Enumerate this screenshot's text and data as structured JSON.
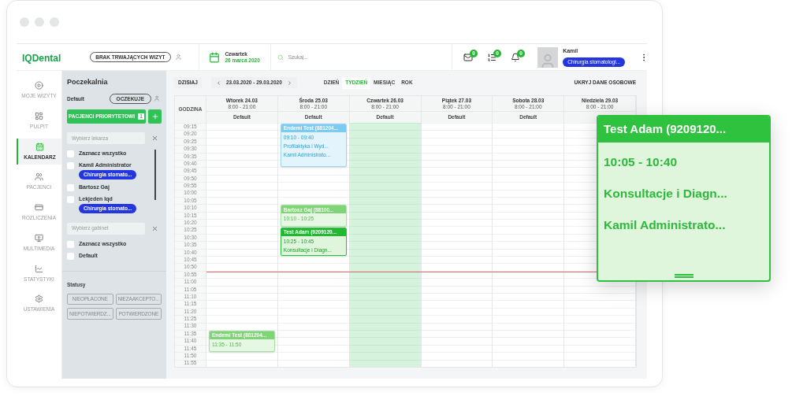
{
  "header": {
    "logo": "IQDental",
    "status_pill": "BRAK TRWAJĄCYCH WIZYT",
    "date": {
      "weekday": "Czwartek",
      "date": "26 marca 2020"
    },
    "search": {
      "placeholder": "Szukaj..."
    },
    "notifications": [
      {
        "kind": "mail",
        "count": "0"
      },
      {
        "kind": "queue",
        "count": "0"
      },
      {
        "kind": "bell",
        "count": "0"
      }
    ],
    "user": {
      "name": "Kamil",
      "role": "Chirurgia stomatologi..."
    }
  },
  "nav": [
    {
      "kind": "play",
      "label": "MOJE WIZYTY",
      "selected": false
    },
    {
      "kind": "dashboard",
      "label": "PULPIT",
      "selected": false
    },
    {
      "kind": "calendar",
      "label": "KALENDARZ",
      "selected": true
    },
    {
      "kind": "patients",
      "label": "PACJENCI",
      "selected": false
    },
    {
      "kind": "billing",
      "label": "ROZLICZENIA",
      "selected": false
    },
    {
      "kind": "media",
      "label": "MULTIMEDIA",
      "selected": false
    },
    {
      "kind": "stats",
      "label": "STATYSTYKI",
      "selected": false
    },
    {
      "kind": "settings",
      "label": "USTAWIENIA",
      "selected": false
    }
  ],
  "waiting_room": {
    "title": "Poczekalnia",
    "room": "Default",
    "status": "OCZEKUJE",
    "priority_button": "PACJENCI PRIORYTETOWI",
    "priority_count": "1",
    "doctor_select": {
      "placeholder": "Wybierz lekarza"
    },
    "doctors": [
      {
        "name": "Zaznacz wszystko",
        "checked": false
      },
      {
        "name": "Kamil Administrator",
        "tag": "Chirurgia stomato...",
        "checked": false
      },
      {
        "name": "Bartosz Gaj",
        "checked": false
      },
      {
        "name": "Lekjeden Iqd",
        "tag": "Chirurgia stomato...",
        "checked": false
      }
    ],
    "room_select": {
      "placeholder": "Wybierz gabinet"
    },
    "rooms": [
      {
        "name": "Zaznacz wszystko",
        "checked": false
      },
      {
        "name": "Default",
        "checked": false
      }
    ],
    "statuses_title": "Statusy",
    "statuses": [
      "NIEOPŁACONE",
      "NIEZAAKCEPTO...",
      "NIEPOTWIERDZ...",
      "POTWIERDZONE"
    ]
  },
  "calendar": {
    "today_button": "DZISIAJ",
    "range": "23.03.2020 - 29.03.2020",
    "views": [
      {
        "label": "DZIEŃ",
        "selected": false
      },
      {
        "label": "TYDZIEŃ",
        "selected": true
      },
      {
        "label": "MIESIĄC",
        "selected": false
      },
      {
        "label": "ROK",
        "selected": false
      }
    ],
    "hide_button": "UKRYJ DANE OSOBOWE",
    "hour_header": "GODZINA",
    "times": [
      "09:15",
      "09:20",
      "09:25",
      "09:30",
      "09:35",
      "09:40",
      "09:45",
      "09:50",
      "09:55",
      "10:00",
      "10:05",
      "10:10",
      "10:15",
      "10:20",
      "10:25",
      "10:30",
      "10:35",
      "10:40",
      "10:45",
      "10:50",
      "10:55",
      "11:00",
      "11:05",
      "11:10",
      "11:15",
      "11:20",
      "11:25",
      "11:30",
      "11:35",
      "11:40",
      "11:45",
      "11:50",
      "11:55"
    ],
    "days": [
      {
        "name": "Wtorek 24.03",
        "hours": "8:00 - 21:00",
        "room": "Default",
        "today": false,
        "events": [
          {
            "kind": "light",
            "title": "Endemi Test (881204...",
            "lines": [
              "11:35 - 11:50"
            ]
          }
        ]
      },
      {
        "name": "Środa 25.03",
        "hours": "8:00 - 21:00",
        "room": "Default",
        "today": false,
        "events": [
          {
            "kind": "blue",
            "title": "Endemi Test (881204...",
            "lines": [
              "09:10 - 09:40",
              "Profilaktyka i Wyd...",
              "Kamil Administrato..."
            ]
          },
          {
            "kind": "light",
            "title": "Bartosz Gaj (88100...",
            "lines": [
              "10:10 - 10:25"
            ]
          },
          {
            "kind": "dark",
            "title": "Test Adam (9209120...",
            "lines": [
              "10:25 - 10:45",
              "Konsultacje i Diagn..."
            ]
          }
        ]
      },
      {
        "name": "Czwartek 26.03",
        "hours": "8:00 - 21:00",
        "room": "Default",
        "today": true
      },
      {
        "name": "Piątek 27.03",
        "hours": "8:00 - 21:00",
        "room": "Default",
        "today": false
      },
      {
        "name": "Sobota 28.03",
        "hours": "8:00 - 21:00",
        "room": "Default",
        "today": false
      },
      {
        "name": "Niedziela 29.03",
        "hours": "8:00 - 21:00",
        "today": false
      }
    ]
  },
  "callout": {
    "title": "Test Adam (9209120...",
    "lines": [
      "10:05 - 10:40",
      "Konsultacje i Diagn...",
      "Kamil Administrato..."
    ]
  }
}
